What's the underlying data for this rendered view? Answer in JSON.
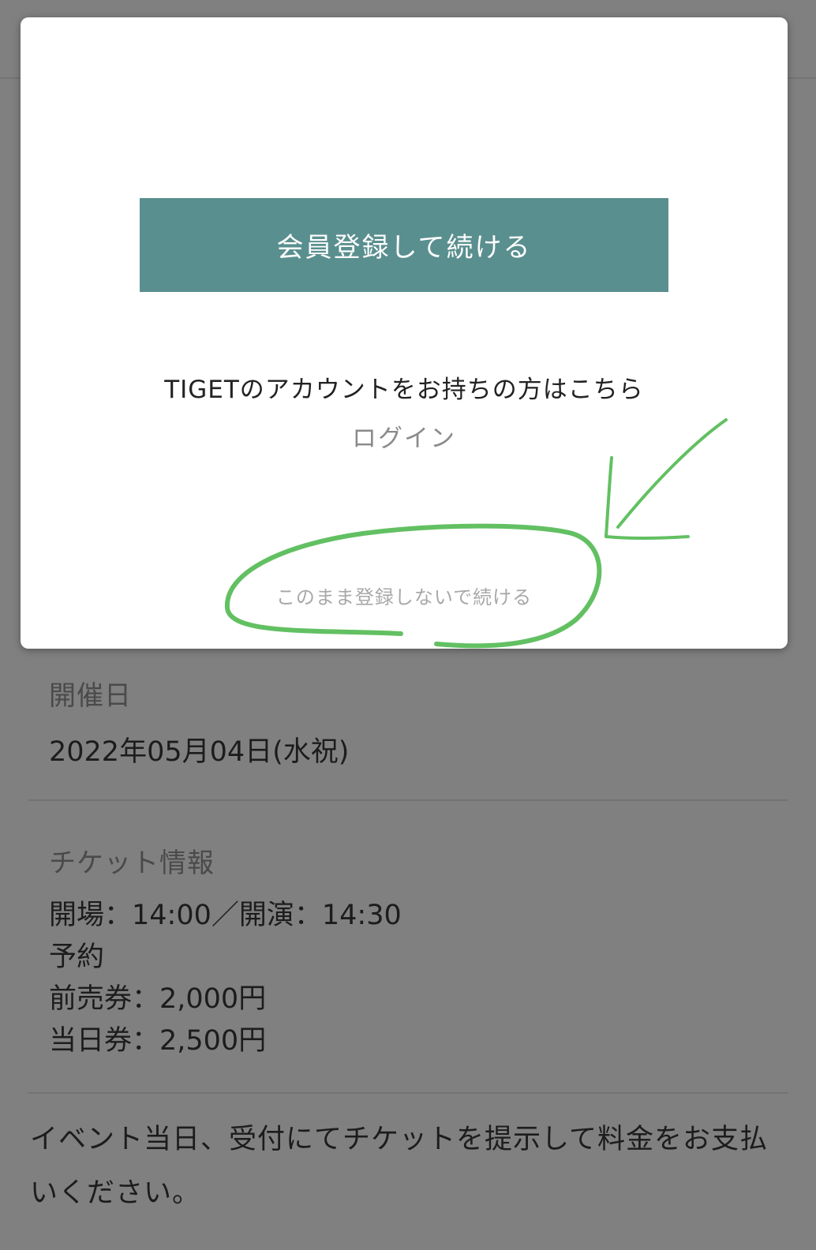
{
  "modal": {
    "signup_button_label": "会員登録して続ける",
    "account_prompt": "TIGETのアカウントをお持ちの方はこちら",
    "login_link": "ログイン",
    "continue_without_signup": "このまま登録しないで続ける"
  },
  "event": {
    "date_label": "開催日",
    "date_value": "2022年05月04日(水祝)",
    "ticket_label": "チケット情報",
    "ticket_lines": [
      "開場：14:00／開演：14:30",
      "予約",
      "前売券：2,000円",
      "当日券：2,500円"
    ],
    "payment_note": "イベント当日、受付にてチケットを提示して料金をお支払いください。"
  },
  "colors": {
    "button": "#5a8f8f",
    "annotation": "#62c062",
    "overlay": "#808080"
  }
}
